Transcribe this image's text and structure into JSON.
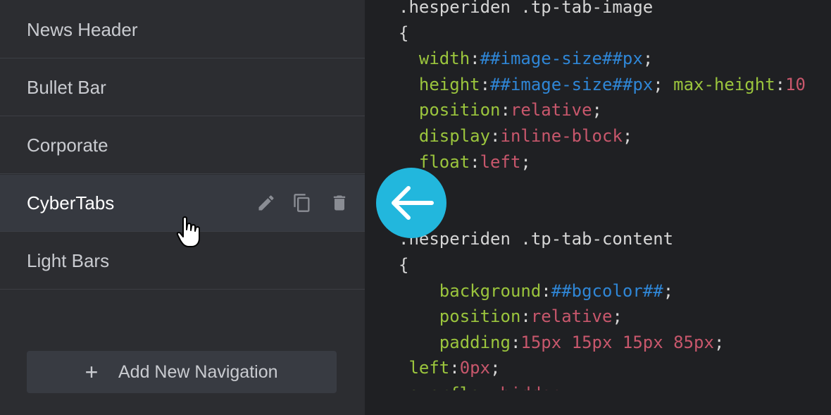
{
  "sidebar": {
    "items": [
      {
        "label": "News Header"
      },
      {
        "label": "Bullet Bar"
      },
      {
        "label": "Corporate"
      },
      {
        "label": "CyberTabs"
      },
      {
        "label": "Light Bars"
      }
    ],
    "active_item": "CyberTabs",
    "actions": {
      "edit_icon": "pencil-icon",
      "duplicate_icon": "copy-icon",
      "delete_icon": "trash-icon"
    },
    "add_button": {
      "icon": "plus-icon",
      "label": "Add New Navigation"
    }
  },
  "back_button": {
    "icon": "arrow-left-icon"
  },
  "colors": {
    "selector": "#d6d6d6",
    "property": "#9bc53d",
    "variable": "#2f86d6",
    "value": "#c8576c",
    "punctuation": "#d6d6d6",
    "accent": "#22b7dd"
  },
  "editor": {
    "lines": [
      {
        "tokens": [
          {
            "t": ".hesperiden .tp-tab-image",
            "c": "selector"
          }
        ]
      },
      {
        "tokens": [
          {
            "t": "{",
            "c": "punctuation"
          }
        ]
      },
      {
        "tokens": [
          {
            "t": "  width",
            "c": "property"
          },
          {
            "t": ":",
            "c": "punctuation"
          },
          {
            "t": "##image-size##",
            "c": "variable"
          },
          {
            "t": "px",
            "c": "variable"
          },
          {
            "t": ";",
            "c": "punctuation"
          }
        ]
      },
      {
        "tokens": [
          {
            "t": "  height",
            "c": "property"
          },
          {
            "t": ":",
            "c": "punctuation"
          },
          {
            "t": "##image-size##",
            "c": "variable"
          },
          {
            "t": "px",
            "c": "variable"
          },
          {
            "t": "; ",
            "c": "punctuation"
          },
          {
            "t": "max-height",
            "c": "property"
          },
          {
            "t": ":",
            "c": "punctuation"
          },
          {
            "t": "10",
            "c": "value"
          }
        ]
      },
      {
        "tokens": [
          {
            "t": "  position",
            "c": "property"
          },
          {
            "t": ":",
            "c": "punctuation"
          },
          {
            "t": "relative",
            "c": "value"
          },
          {
            "t": ";",
            "c": "punctuation"
          }
        ]
      },
      {
        "tokens": [
          {
            "t": "  display",
            "c": "property"
          },
          {
            "t": ":",
            "c": "punctuation"
          },
          {
            "t": "inline-block",
            "c": "value"
          },
          {
            "t": ";",
            "c": "punctuation"
          }
        ]
      },
      {
        "tokens": [
          {
            "t": "  float",
            "c": "property"
          },
          {
            "t": ":",
            "c": "punctuation"
          },
          {
            "t": "left",
            "c": "value"
          },
          {
            "t": ";",
            "c": "punctuation"
          }
        ]
      },
      {
        "tokens": []
      },
      {
        "tokens": []
      },
      {
        "tokens": [
          {
            "t": ".hesperiden .tp-tab-content",
            "c": "selector"
          }
        ]
      },
      {
        "tokens": [
          {
            "t": "{",
            "c": "punctuation"
          }
        ]
      },
      {
        "tokens": [
          {
            "t": "    background",
            "c": "property"
          },
          {
            "t": ":",
            "c": "punctuation"
          },
          {
            "t": "##bgcolor##",
            "c": "variable"
          },
          {
            "t": ";",
            "c": "punctuation"
          }
        ]
      },
      {
        "tokens": [
          {
            "t": "    position",
            "c": "property"
          },
          {
            "t": ":",
            "c": "punctuation"
          },
          {
            "t": "relative",
            "c": "value"
          },
          {
            "t": ";",
            "c": "punctuation"
          }
        ]
      },
      {
        "tokens": [
          {
            "t": "    padding",
            "c": "property"
          },
          {
            "t": ":",
            "c": "punctuation"
          },
          {
            "t": "15px 15px 15px 85px",
            "c": "value"
          },
          {
            "t": ";",
            "c": "punctuation"
          }
        ]
      },
      {
        "tokens": [
          {
            "t": " left",
            "c": "property"
          },
          {
            "t": ":",
            "c": "punctuation"
          },
          {
            "t": "0px",
            "c": "value"
          },
          {
            "t": ";",
            "c": "punctuation"
          }
        ]
      },
      {
        "tokens": [
          {
            "t": " overflow",
            "c": "property"
          },
          {
            "t": ":",
            "c": "punctuation"
          },
          {
            "t": "hidden",
            "c": "value"
          },
          {
            "t": ";",
            "c": "punctuation"
          }
        ]
      }
    ]
  }
}
